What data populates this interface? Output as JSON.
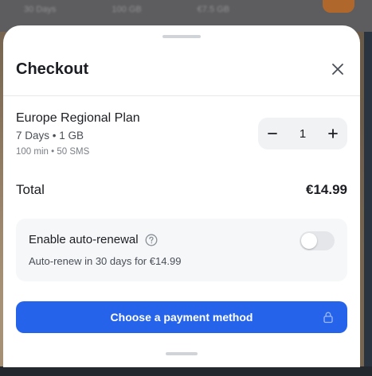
{
  "backdrop": {
    "row": [
      "30 Days",
      "100 GB",
      "€7.5 GB"
    ]
  },
  "sheet": {
    "title": "Checkout",
    "close_icon": "close-icon"
  },
  "plan": {
    "name": "Europe Regional Plan",
    "summary": "7 Days • 1 GB",
    "extra": "100 min • 50 SMS",
    "quantity": "1",
    "decrement_icon": "minus-icon",
    "increment_icon": "plus-icon"
  },
  "total": {
    "label": "Total",
    "value": "€14.99"
  },
  "renewal": {
    "title": "Enable auto-renewal",
    "help_icon": "help-circle-icon",
    "subtitle": "Auto-renew in 30 days for €14.99",
    "enabled": false
  },
  "payment": {
    "label": "Choose a payment method",
    "lock_icon": "lock-icon"
  },
  "colors": {
    "primary": "#2563eb",
    "surface": "#ffffff",
    "card": "#f6f7f9",
    "text": "#1b1d22"
  }
}
